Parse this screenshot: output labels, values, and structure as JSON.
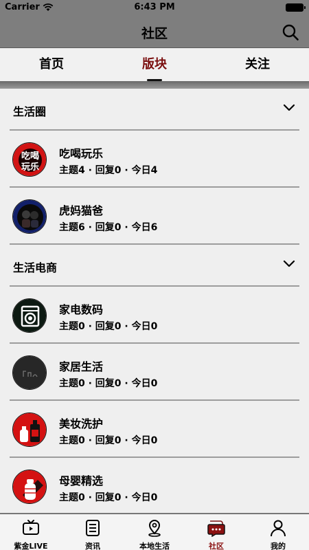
{
  "status": {
    "carrier": "Carrier",
    "time": "6:43 PM"
  },
  "nav": {
    "title": "社区"
  },
  "tabs": [
    {
      "label": "首页",
      "active": false
    },
    {
      "label": "版块",
      "active": true
    },
    {
      "label": "关注",
      "active": false
    }
  ],
  "sections": [
    {
      "label": "生活圈",
      "items": [
        {
          "title": "吃喝玩乐",
          "meta": "主题4 · 回复0 · 今日4",
          "icon": "food-fun-icon"
        },
        {
          "title": "虎妈猫爸",
          "meta": "主题6 · 回复0 · 今日6",
          "icon": "parents-icon"
        }
      ]
    },
    {
      "label": "生活电商",
      "items": [
        {
          "title": "家电数码",
          "meta": "主题0 · 回复0 · 今日0",
          "icon": "washing-machine-icon"
        },
        {
          "title": "家居生活",
          "meta": "主题0 · 回复0 · 今日0",
          "icon": "home-life-icon"
        },
        {
          "title": "美妆洗护",
          "meta": "主题0 · 回复0 · 今日0",
          "icon": "cosmetics-icon"
        },
        {
          "title": "母婴精选",
          "meta": "主题0 · 回复0 · 今日0",
          "icon": "baby-bottle-icon"
        }
      ]
    }
  ],
  "bottom_tabs": [
    {
      "label": "紫金LIVE",
      "icon": "tv-icon",
      "active": false
    },
    {
      "label": "资讯",
      "icon": "news-icon",
      "active": false
    },
    {
      "label": "本地生活",
      "icon": "location-icon",
      "active": false
    },
    {
      "label": "社区",
      "icon": "chat-icon",
      "active": true
    },
    {
      "label": "我的",
      "icon": "profile-icon",
      "active": false
    }
  ],
  "colors": {
    "accent": "#8a1010",
    "navbar": "#7e7e7e",
    "background": "#efefef"
  }
}
